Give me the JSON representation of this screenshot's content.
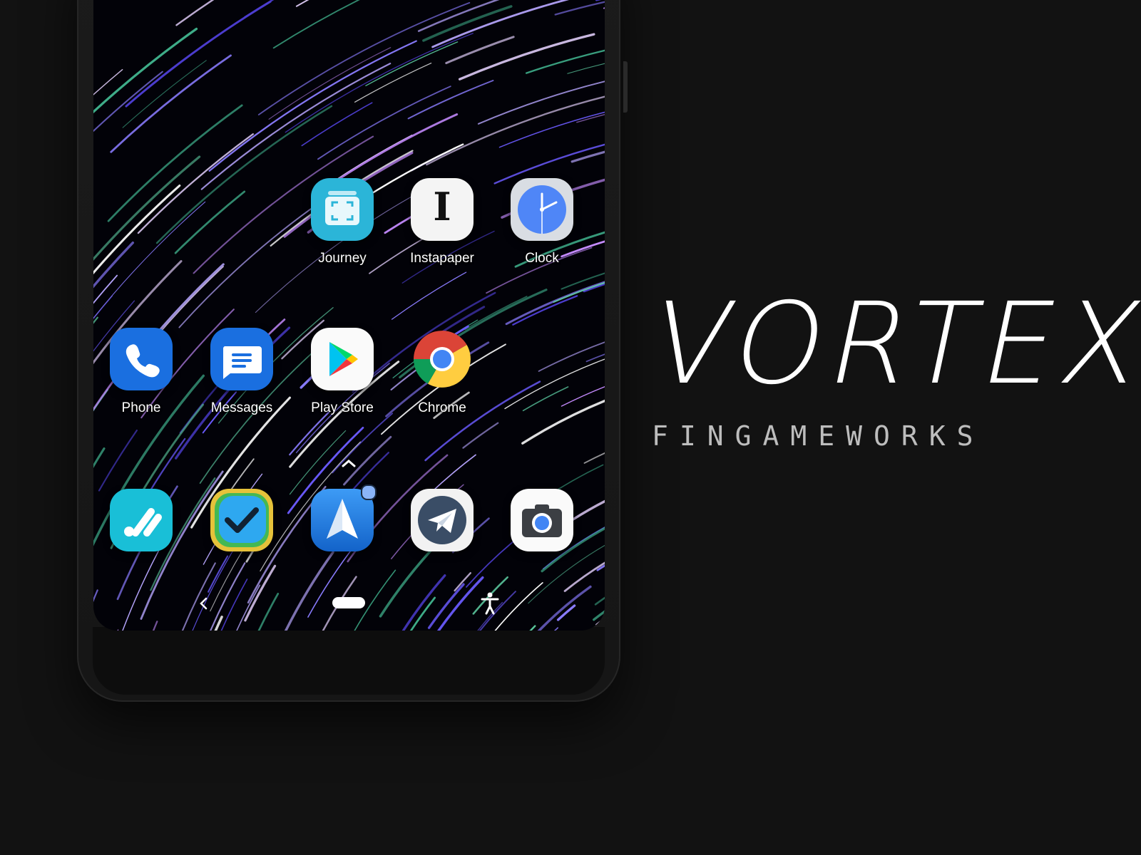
{
  "home_screen": {
    "row1": [
      {
        "name": "journey",
        "label": "Journey"
      },
      {
        "name": "instapaper",
        "label": "Instapaper"
      },
      {
        "name": "clock",
        "label": "Clock"
      }
    ],
    "row2": [
      {
        "name": "phone",
        "label": "Phone"
      },
      {
        "name": "messages",
        "label": "Messages"
      },
      {
        "name": "play-store",
        "label": "Play Store"
      },
      {
        "name": "chrome",
        "label": "Chrome"
      }
    ],
    "dock_icons": [
      "tasks-icon",
      "checkmark-icon",
      "spark-mail-icon",
      "telegram-icon",
      "camera-icon"
    ],
    "instapaper_glyph": "I"
  },
  "navigation": {
    "icons": [
      "back-icon",
      "home-pill",
      "accessibility-icon"
    ]
  },
  "branding": {
    "title": "VORTEX",
    "subtitle": "FINGAMEWORKS"
  },
  "colors": {
    "background": "#121212",
    "phone_blue": "#1a73e8",
    "journey_teal": "#29b6d6",
    "clock_blue": "#4f86f7"
  }
}
